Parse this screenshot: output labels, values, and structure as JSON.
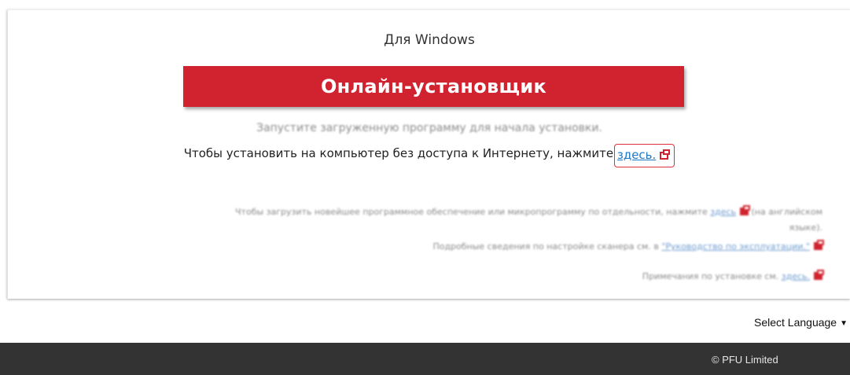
{
  "card": {
    "os_title": "Для Windows",
    "install_button": "Онлайн-установщик",
    "run_hint": "Запустите загруженную программу для начала установки.",
    "offline_text": "Чтобы установить на компьютер без доступа к Интернету, нажмите",
    "offline_link": "здесь.",
    "note1_text": "Чтобы загрузить новейшее программное обеспечение или микропрограмму по отдельности, нажмите",
    "note1_link": "здесь",
    "note1_suffix": "(на английском",
    "note1_suffix2": "языке).",
    "note2_text": "Подробные сведения по настройке сканера см. в",
    "note2_link": "\"Руководство по эксплуатации.\"",
    "note3_text": "Примечания по установке см.",
    "note3_link": "здесь."
  },
  "language": {
    "label": "Select Language",
    "caret": "▼"
  },
  "footer": {
    "copyright": "© PFU Limited"
  },
  "colors": {
    "accent": "#d0232f",
    "link": "#1f79c4",
    "footer_bg": "#333333"
  },
  "icons": {
    "external_link": "external-link-icon",
    "dropdown": "chevron-down-icon"
  }
}
